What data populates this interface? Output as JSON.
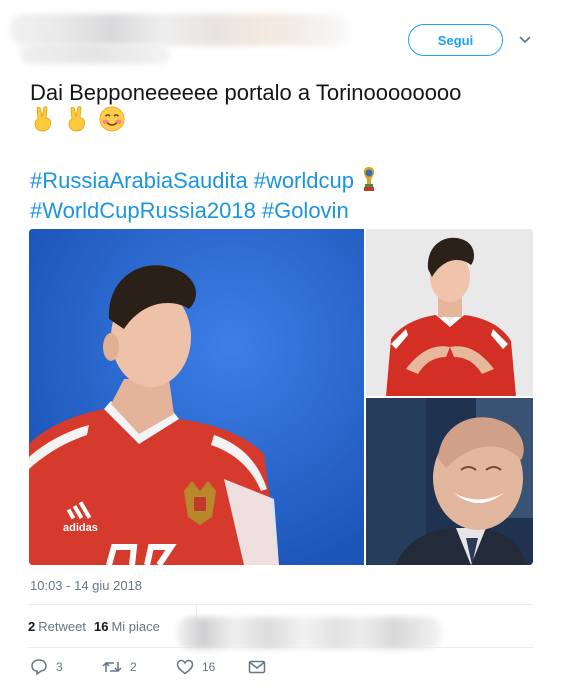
{
  "header": {
    "follow_label": "Segui"
  },
  "tweet": {
    "text": "Dai Bepponeeeeee portalo a Torinoooooooo",
    "emojis": [
      "victory-hand-icon",
      "victory-hand-icon",
      "smiling-face-blush-icon"
    ],
    "hashtags": [
      "#RussiaArabiaSaudita",
      "#worldcup",
      "#WorldCupRussia2018",
      "#Golovin"
    ],
    "timestamp": "10:03 - 14 giu 2018"
  },
  "stats": {
    "retweets_count": "2",
    "retweets_label": "Retweet",
    "likes_count": "16",
    "likes_label": "Mi piace"
  },
  "actions": {
    "reply_count": "3",
    "retweet_count": "2",
    "like_count": "16"
  },
  "colors": {
    "link": "#1b95e0",
    "accent": "#1da1f2",
    "muted": "#657786",
    "text": "#14171a"
  }
}
